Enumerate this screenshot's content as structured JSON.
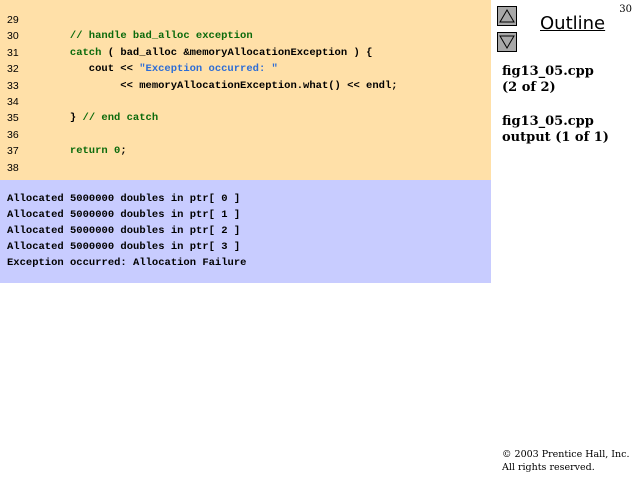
{
  "slide": {
    "number": "30"
  },
  "nav": {
    "outline_label": "Outline"
  },
  "code": {
    "lines": [
      {
        "num": "29",
        "parts": []
      },
      {
        "num": "30",
        "parts": [
          {
            "t": "   ",
            "c": ""
          },
          {
            "t": "// handle bad_alloc exception",
            "c": "cm"
          }
        ]
      },
      {
        "num": "31",
        "parts": [
          {
            "t": "   ",
            "c": ""
          },
          {
            "t": "catch",
            "c": "kw"
          },
          {
            "t": " ( bad_alloc &memoryAllocationException ) {",
            "c": ""
          }
        ]
      },
      {
        "num": "32",
        "parts": [
          {
            "t": "      cout << ",
            "c": ""
          },
          {
            "t": "\"Exception occurred: \"",
            "c": "str"
          }
        ]
      },
      {
        "num": "33",
        "parts": [
          {
            "t": "           << memoryAllocationException.what() << endl;",
            "c": ""
          }
        ]
      },
      {
        "num": "34",
        "parts": []
      },
      {
        "num": "35",
        "parts": [
          {
            "t": "   } ",
            "c": ""
          },
          {
            "t": "// end catch",
            "c": "cm"
          }
        ]
      },
      {
        "num": "36",
        "parts": []
      },
      {
        "num": "37",
        "parts": [
          {
            "t": "   ",
            "c": ""
          },
          {
            "t": "return",
            "c": "kw"
          },
          {
            "t": " ",
            "c": ""
          },
          {
            "t": "0",
            "c": "kw"
          },
          {
            "t": ";",
            "c": ""
          }
        ]
      },
      {
        "num": "38",
        "parts": []
      }
    ]
  },
  "output": {
    "lines": [
      "Allocated 5000000 doubles in ptr[ 0 ]",
      "Allocated 5000000 doubles in ptr[ 1 ]",
      "Allocated 5000000 doubles in ptr[ 2 ]",
      "Allocated 5000000 doubles in ptr[ 3 ]",
      "Exception occurred: Allocation Failure"
    ]
  },
  "sidebar": {
    "file_name_1": "fig13_05.cpp",
    "page_info_1": "(2 of 2)",
    "file_name_2": "fig13_05.cpp",
    "page_info_2": "output (1 of 1)"
  },
  "footer": {
    "copyright": "© 2003 Prentice Hall, Inc.",
    "rights": "All rights reserved."
  },
  "colors": {
    "code_bg": "#ffe0a8",
    "output_bg": "#c8ccff",
    "keyword": "#0b6a0b",
    "string": "#2d6dd6"
  }
}
